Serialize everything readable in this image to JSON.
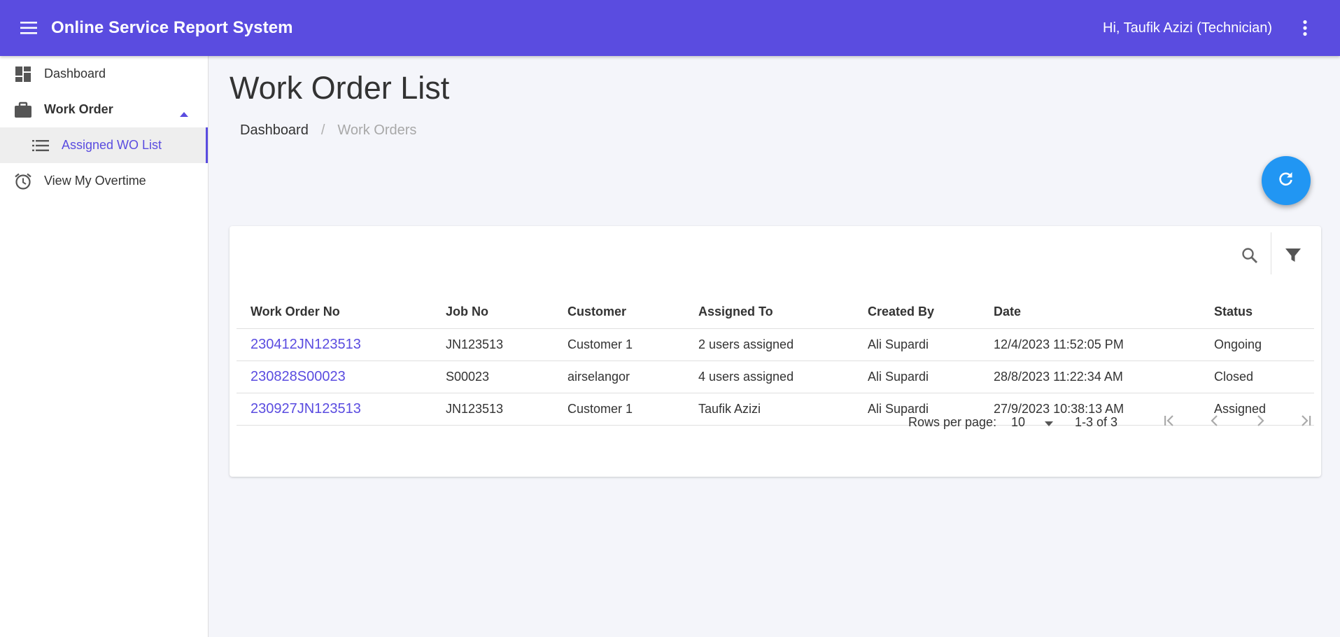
{
  "app": {
    "title": "Online Service Report System",
    "greeting": "Hi, Taufik Azizi (Technician)",
    "accent_color": "#5a4ce0",
    "fab_color": "#2196f3"
  },
  "sidebar": {
    "items": [
      {
        "label": "Dashboard",
        "icon": "dashboard-icon"
      },
      {
        "label": "Work Order",
        "icon": "briefcase-icon",
        "expanded": true
      },
      {
        "label": "Assigned WO List",
        "icon": "list-icon",
        "selected": true
      },
      {
        "label": "View My Overtime",
        "icon": "alarm-clock-icon"
      }
    ]
  },
  "page": {
    "title": "Work Order List",
    "breadcrumb": {
      "home": "Dashboard",
      "separator": "/",
      "current": "Work Orders"
    }
  },
  "table": {
    "columns": [
      "Work Order No",
      "Job No",
      "Customer",
      "Assigned To",
      "Created By",
      "Date",
      "Status"
    ],
    "rows": [
      [
        "230412JN123513",
        "JN123513",
        "Customer 1",
        "2 users assigned",
        "Ali Supardi",
        "12/4/2023 11:52:05 PM",
        "Ongoing"
      ],
      [
        "230828S00023",
        "S00023",
        "airselangor",
        "4 users assigned",
        "Ali Supardi",
        "28/8/2023 11:22:34 AM",
        "Closed"
      ],
      [
        "230927JN123513",
        "JN123513",
        "Customer 1",
        "Taufik Azizi",
        "Ali Supardi",
        "27/9/2023 10:38:13 AM",
        "Assigned"
      ]
    ]
  },
  "pagination": {
    "rows_per_page_label": "Rows per page:",
    "rows_per_page": "10",
    "range": "1-3 of 3"
  }
}
